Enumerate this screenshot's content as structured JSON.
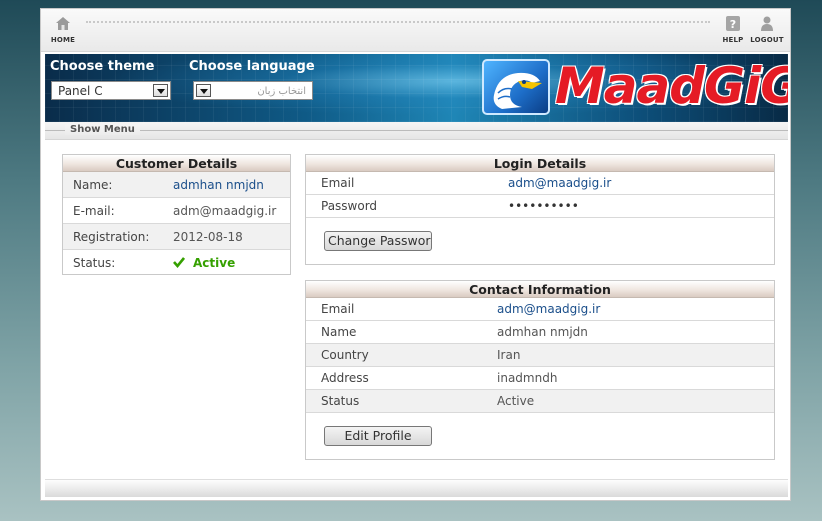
{
  "topbar": {
    "home_label": "HOME",
    "help_label": "HELP",
    "logout_label": "LOGOUT"
  },
  "banner": {
    "theme_label": "Choose theme",
    "theme_value": "Panel C",
    "language_label": "Choose language",
    "language_value": "انتخاب زبان",
    "logo_text": "MaadGiG"
  },
  "menu": {
    "show_menu_label": "Show Menu"
  },
  "customer": {
    "title": "Customer Details",
    "rows": [
      {
        "label": "Name:",
        "value": "admhan nmjdn"
      },
      {
        "label": "E-mail:",
        "value": "adm@maadgig.ir"
      },
      {
        "label": "Registration:",
        "value": "2012-08-18"
      },
      {
        "label": "Status:",
        "value": "Active"
      }
    ]
  },
  "login": {
    "title": "Login Details",
    "rows": [
      {
        "label": "Email",
        "value": "adm@maadgig.ir"
      },
      {
        "label": "Password",
        "value": "••••••••••"
      }
    ],
    "change_password_label": "Change Password"
  },
  "contact": {
    "title": "Contact Information",
    "rows": [
      {
        "label": "Email",
        "value": "adm@maadgig.ir"
      },
      {
        "label": "Name",
        "value": "admhan nmjdn"
      },
      {
        "label": "Country",
        "value": "Iran"
      },
      {
        "label": "Address",
        "value": "inadmndh"
      },
      {
        "label": "Status",
        "value": "Active"
      }
    ],
    "edit_profile_label": "Edit Profile"
  },
  "colors": {
    "brand_red": "#e51b25",
    "status_green": "#35a000",
    "link_blue": "#1b4f8b"
  }
}
